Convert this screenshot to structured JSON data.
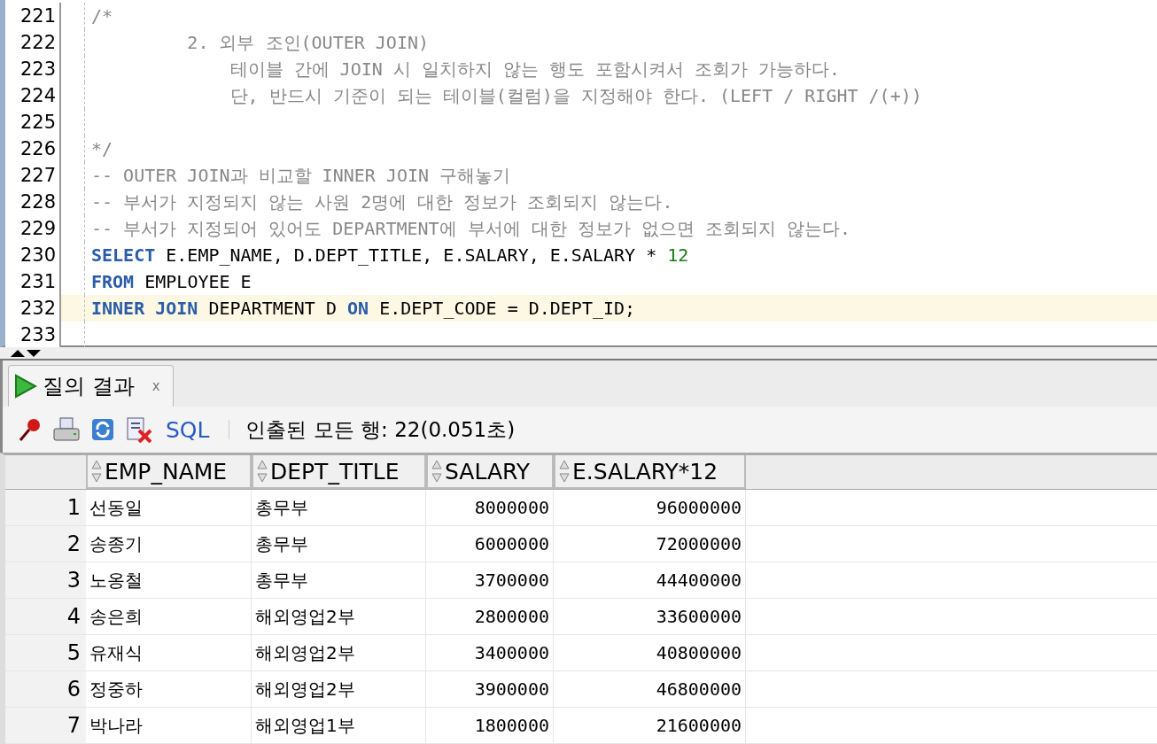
{
  "editor": {
    "lines": [
      {
        "number": "221",
        "current": false,
        "tokens": [
          {
            "kind": "comment",
            "text": "/*"
          }
        ]
      },
      {
        "number": "222",
        "current": false,
        "tokens": [
          {
            "kind": "comment",
            "text": "         2. 외부 조인(OUTER JOIN)"
          }
        ]
      },
      {
        "number": "223",
        "current": false,
        "tokens": [
          {
            "kind": "comment",
            "text": "             테이블 간에 JOIN 시 일치하지 않는 행도 포함시켜서 조회가 가능하다."
          }
        ]
      },
      {
        "number": "224",
        "current": false,
        "tokens": [
          {
            "kind": "comment",
            "text": "             단, 반드시 기준이 되는 테이블(컬럼)을 지정해야 한다. (LEFT / RIGHT /(+))"
          }
        ]
      },
      {
        "number": "225",
        "current": false
      },
      {
        "number": "226",
        "current": false,
        "tokens": [
          {
            "kind": "comment",
            "text": "*/"
          }
        ]
      },
      {
        "number": "227",
        "current": false,
        "tokens": [
          {
            "kind": "comment",
            "text": "-- OUTER JOIN과 비교할 INNER JOIN 구해놓기"
          }
        ]
      },
      {
        "number": "228",
        "current": false,
        "tokens": [
          {
            "kind": "comment",
            "text": "-- 부서가 지정되지 않는 사원 2명에 대한 정보가 조회되지 않는다."
          }
        ]
      },
      {
        "number": "229",
        "current": false,
        "tokens": [
          {
            "kind": "comment",
            "text": "-- 부서가 지정되어 있어도 DEPARTMENT에 부서에 대한 정보가 없으면 조회되지 않는다."
          }
        ]
      },
      {
        "number": "230",
        "current": false,
        "tokens": [
          {
            "kind": "keyword",
            "text": "SELECT"
          },
          {
            "kind": "plain",
            "text": " E.EMP_NAME, D.DEPT_TITLE, E.SALARY, E.SALARY * "
          },
          {
            "kind": "number",
            "text": "12"
          }
        ]
      },
      {
        "number": "231",
        "current": false,
        "tokens": [
          {
            "kind": "keyword",
            "text": "FROM"
          },
          {
            "kind": "plain",
            "text": " EMPLOYEE E"
          }
        ]
      },
      {
        "number": "232",
        "current": true,
        "tokens": [
          {
            "kind": "keyword",
            "text": "INNER JOIN"
          },
          {
            "kind": "plain",
            "text": " DEPARTMENT D "
          },
          {
            "kind": "keyword",
            "text": "ON"
          },
          {
            "kind": "plain",
            "text": " E.DEPT_CODE = D.DEPT_ID;"
          }
        ]
      },
      {
        "number": "233",
        "current": false
      }
    ]
  },
  "results_tab": {
    "label": "질의 결과",
    "close": "x",
    "selected": true
  },
  "toolbar": {
    "sql_label": "SQL",
    "status": "인출된 모든 행: 22(0.051초)"
  },
  "table": {
    "columns": [
      {
        "label": "EMP_NAME",
        "kind": "text"
      },
      {
        "label": "DEPT_TITLE",
        "kind": "text"
      },
      {
        "label": "SALARY",
        "kind": "number"
      },
      {
        "label": "E.SALARY*12",
        "kind": "number"
      }
    ],
    "rows": [
      {
        "number": "1",
        "cells": [
          "선동일",
          "총무부",
          "8000000",
          "96000000"
        ]
      },
      {
        "number": "2",
        "cells": [
          "송종기",
          "총무부",
          "6000000",
          "72000000"
        ]
      },
      {
        "number": "3",
        "cells": [
          "노옹철",
          "총무부",
          "3700000",
          "44400000"
        ]
      },
      {
        "number": "4",
        "cells": [
          "송은희",
          "해외영업2부",
          "2800000",
          "33600000"
        ]
      },
      {
        "number": "5",
        "cells": [
          "유재식",
          "해외영업2부",
          "3400000",
          "40800000"
        ]
      },
      {
        "number": "6",
        "cells": [
          "정중하",
          "해외영업2부",
          "3900000",
          "46800000"
        ]
      },
      {
        "number": "7",
        "cells": [
          "박나라",
          "해외영업1부",
          "1800000",
          "21600000"
        ]
      }
    ]
  }
}
